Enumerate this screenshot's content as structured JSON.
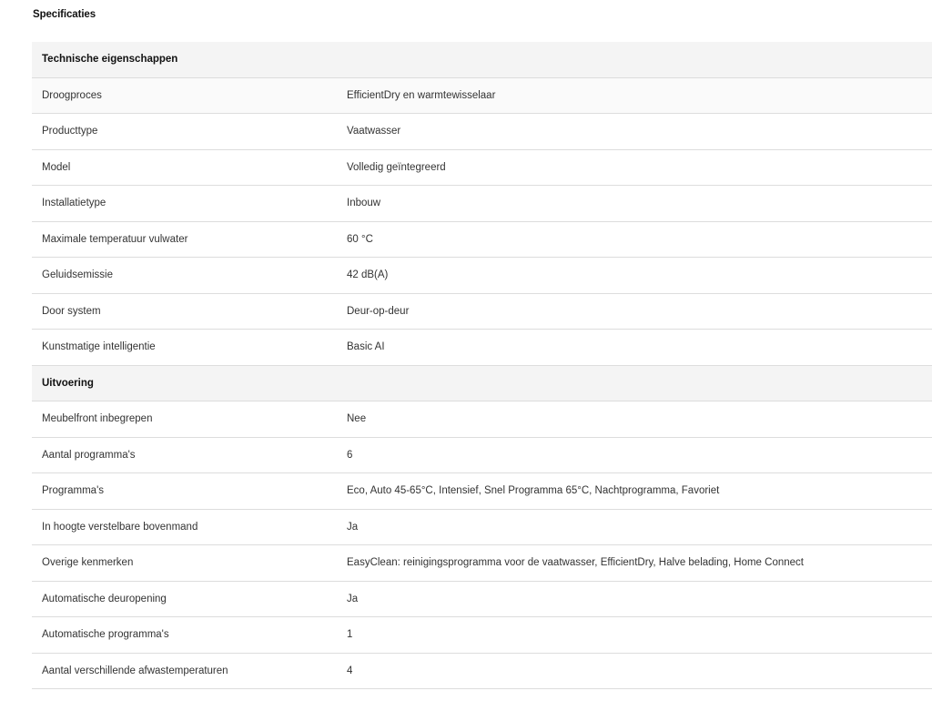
{
  "page": {
    "title": "Specificaties"
  },
  "sections": [
    {
      "title": "Technische eigenschappen",
      "rows": [
        {
          "label": "Droogproces",
          "value": "EfficientDry en warmtewisselaar"
        },
        {
          "label": "Producttype",
          "value": "Vaatwasser"
        },
        {
          "label": "Model",
          "value": "Volledig geïntegreerd"
        },
        {
          "label": "Installatietype",
          "value": "Inbouw"
        },
        {
          "label": "Maximale temperatuur vulwater",
          "value": "60 °C"
        },
        {
          "label": "Geluidsemissie",
          "value": "42 dB(A)"
        },
        {
          "label": "Door system",
          "value": "Deur-op-deur"
        },
        {
          "label": "Kunstmatige intelligentie",
          "value": "Basic AI"
        }
      ]
    },
    {
      "title": "Uitvoering",
      "rows": [
        {
          "label": "Meubelfront inbegrepen",
          "value": "Nee"
        },
        {
          "label": "Aantal programma's",
          "value": "6"
        },
        {
          "label": "Programma's",
          "value": "Eco, Auto 45-65°C, Intensief, Snel Programma 65°C, Nachtprogramma, Favoriet"
        },
        {
          "label": "In hoogte verstelbare bovenmand",
          "value": "Ja"
        },
        {
          "label": "Overige kenmerken",
          "value": "EasyClean: reinigingsprogramma voor de vaatwasser, EfficientDry, Halve belading, Home Connect"
        },
        {
          "label": "Automatische deuropening",
          "value": "Ja"
        },
        {
          "label": "Automatische programma's",
          "value": "1"
        },
        {
          "label": "Aantal verschillende afwastemperaturen",
          "value": "4"
        }
      ]
    }
  ]
}
